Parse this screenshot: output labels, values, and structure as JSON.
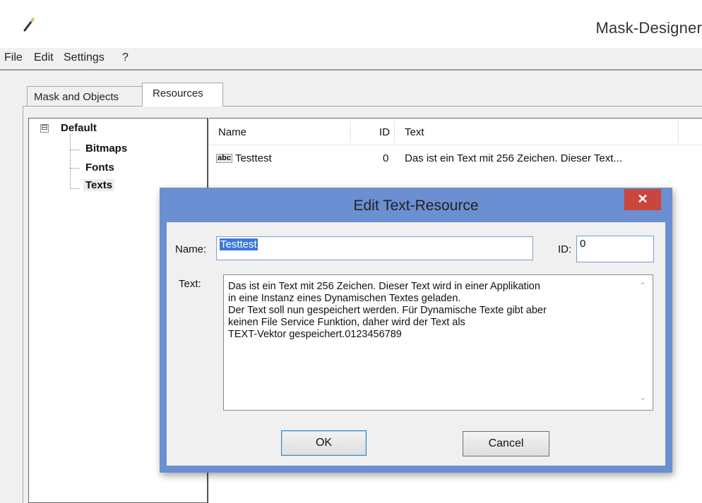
{
  "window": {
    "title": "Mask-Designer",
    "icon": "pencil-icon"
  },
  "menu": {
    "items": [
      "File",
      "Edit",
      "Settings",
      "?"
    ]
  },
  "tabs": [
    {
      "label": "Mask and Objects",
      "active": false
    },
    {
      "label": "Resources",
      "active": true
    }
  ],
  "tree": {
    "root": "Default",
    "toggle": "⊟",
    "children": [
      {
        "label": "Bitmaps",
        "selected": false
      },
      {
        "label": "Fonts",
        "selected": false
      },
      {
        "label": "Texts",
        "selected": true
      }
    ]
  },
  "list": {
    "columns": [
      "Name",
      "ID",
      "Text"
    ],
    "rows": [
      {
        "icon": "abc",
        "name": "Testtest",
        "id": "0",
        "text": "Das ist ein Text mit 256 Zeichen. Dieser Text..."
      }
    ]
  },
  "dialog": {
    "title": "Edit Text-Resource",
    "close_glyph": "✕",
    "name_label": "Name:",
    "name_value": "Testtest",
    "id_label": "ID:",
    "id_value": "0",
    "text_label": "Text:",
    "text_value": "Das ist ein Text mit 256 Zeichen. Dieser Text wird in einer Applikation\nin eine Instanz eines Dynamischen Textes geladen.\nDer Text soll nun gespeichert werden. Für Dynamische Texte gibt aber\nkeinen File Service Funktion, daher wird der Text als\nTEXT-Vektor gespeichert.0123456789",
    "scroll_up": "⌃",
    "scroll_down": "⌄",
    "ok_label": "OK",
    "cancel_label": "Cancel"
  },
  "colors": {
    "dialog_frame": "#6b8fd0",
    "close_button": "#c9463d",
    "selection": "#3a78d8"
  }
}
